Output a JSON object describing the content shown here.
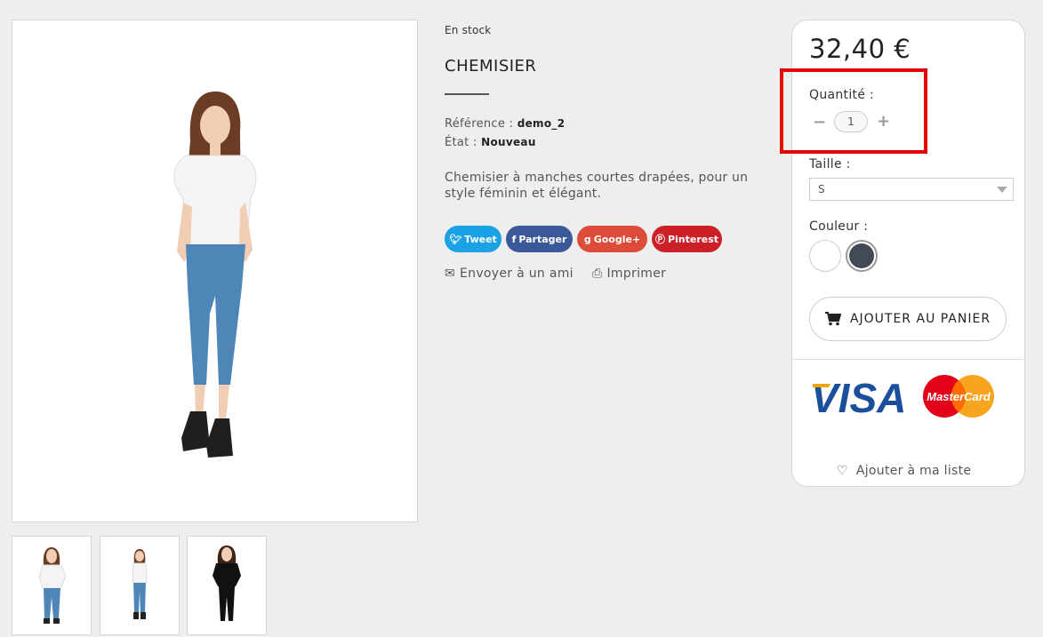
{
  "product": {
    "stock_status": "En stock",
    "title": "CHEMISIER",
    "reference_label": "Référence :",
    "reference_value": "demo_2",
    "condition_label": "État :",
    "condition_value": "Nouveau",
    "description": "Chemisier à manches courtes drapées, pour un style féminin et élégant."
  },
  "social": {
    "tweet": "Tweet",
    "facebook": "Partager",
    "google": "Google+",
    "pinterest": "Pinterest"
  },
  "links": {
    "send_friend": "Envoyer à un ami",
    "print": "Imprimer"
  },
  "buy_box": {
    "price": "32,40 €",
    "quantity_label": "Quantité :",
    "quantity_value": "1",
    "size_label": "Taille :",
    "size_selected": "S",
    "color_label": "Couleur :",
    "colors": [
      "#ffffff",
      "#434a54"
    ],
    "add_to_cart": "AJOUTER AU PANIER",
    "wishlist": "Ajouter à ma liste",
    "payment_logos": [
      "VISA",
      "MasterCard"
    ]
  },
  "colors": {
    "twitter": "#1aa1e6",
    "facebook": "#3b5998",
    "google": "#dd4b39",
    "pinterest": "#cb2027",
    "highlight": "#e60000"
  }
}
